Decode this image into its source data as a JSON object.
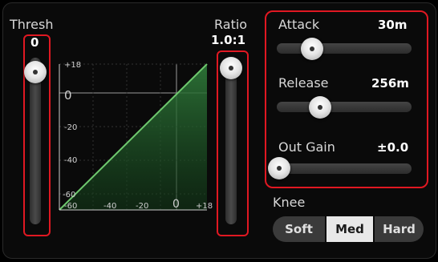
{
  "thresh": {
    "label": "Thresh",
    "value": "0"
  },
  "ratio": {
    "label": "Ratio",
    "value": "1.0:1"
  },
  "attack": {
    "label": "Attack",
    "value": "30m"
  },
  "release": {
    "label": "Release",
    "value": "256m"
  },
  "out_gain": {
    "label": "Out Gain",
    "value": "±0.0"
  },
  "knee": {
    "label": "Knee",
    "options": [
      "Soft",
      "Med",
      "Hard"
    ],
    "selected": "Med"
  },
  "graph": {
    "y_ticks": [
      "+18",
      "0",
      "-20",
      "-40",
      "-60"
    ],
    "x_ticks": [
      "-60",
      "-40",
      "-20",
      "0",
      "+18"
    ]
  },
  "colors": {
    "highlight": "#e01822",
    "curve": "#6ec86e"
  }
}
